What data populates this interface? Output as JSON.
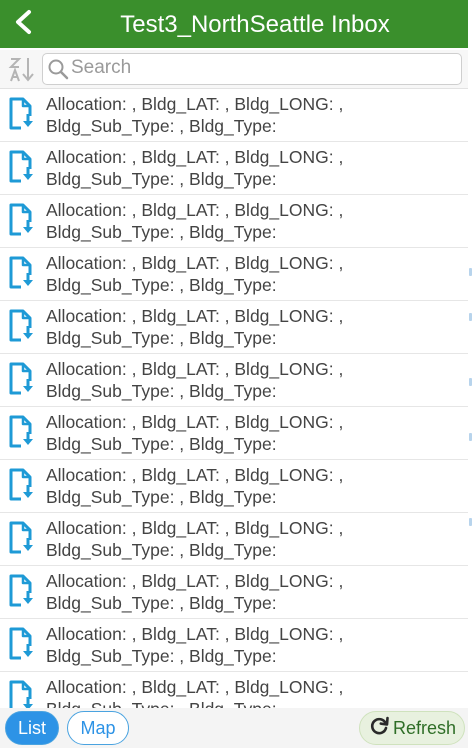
{
  "header": {
    "title": "Test3_NorthSeattle Inbox"
  },
  "search": {
    "placeholder": "Search",
    "value": ""
  },
  "rows": [
    {
      "line1": "Allocation: , Bldg_LAT: , Bldg_LONG: ,",
      "line2": "Bldg_Sub_Type: , Bldg_Type:"
    },
    {
      "line1": "Allocation: , Bldg_LAT: , Bldg_LONG: ,",
      "line2": "Bldg_Sub_Type: , Bldg_Type:"
    },
    {
      "line1": "Allocation: , Bldg_LAT: , Bldg_LONG: ,",
      "line2": "Bldg_Sub_Type: , Bldg_Type:"
    },
    {
      "line1": "Allocation: , Bldg_LAT: , Bldg_LONG: ,",
      "line2": "Bldg_Sub_Type: , Bldg_Type:"
    },
    {
      "line1": "Allocation: , Bldg_LAT: , Bldg_LONG: ,",
      "line2": "Bldg_Sub_Type: , Bldg_Type:"
    },
    {
      "line1": "Allocation: , Bldg_LAT: , Bldg_LONG: ,",
      "line2": "Bldg_Sub_Type: , Bldg_Type:"
    },
    {
      "line1": "Allocation: , Bldg_LAT: , Bldg_LONG: ,",
      "line2": "Bldg_Sub_Type: , Bldg_Type:"
    },
    {
      "line1": "Allocation: , Bldg_LAT: , Bldg_LONG: ,",
      "line2": "Bldg_Sub_Type: , Bldg_Type:"
    },
    {
      "line1": "Allocation: , Bldg_LAT: , Bldg_LONG: ,",
      "line2": "Bldg_Sub_Type: , Bldg_Type:"
    },
    {
      "line1": "Allocation: , Bldg_LAT: , Bldg_LONG: ,",
      "line2": "Bldg_Sub_Type: , Bldg_Type:"
    },
    {
      "line1": "Allocation: , Bldg_LAT: , Bldg_LONG: ,",
      "line2": "Bldg_Sub_Type: , Bldg_Type:"
    },
    {
      "line1": "Allocation: , Bldg_LAT: , Bldg_LONG: ,",
      "line2": "Bldg_Sub_Type: , Bldg_Type:"
    }
  ],
  "bottom_bar": {
    "list_label": "List",
    "map_label": "Map",
    "refresh_label": "Refresh"
  },
  "icons": {
    "back": "chevron-left-icon",
    "sort": "sort-alpha-icon",
    "search": "search-icon",
    "row": "document-download-icon",
    "refresh": "refresh-icon"
  },
  "colors": {
    "header": "#3a8f2c",
    "accent": "#2d93e6",
    "doc_icon": "#1e9ad6",
    "refresh_bg": "#e8f1df"
  }
}
